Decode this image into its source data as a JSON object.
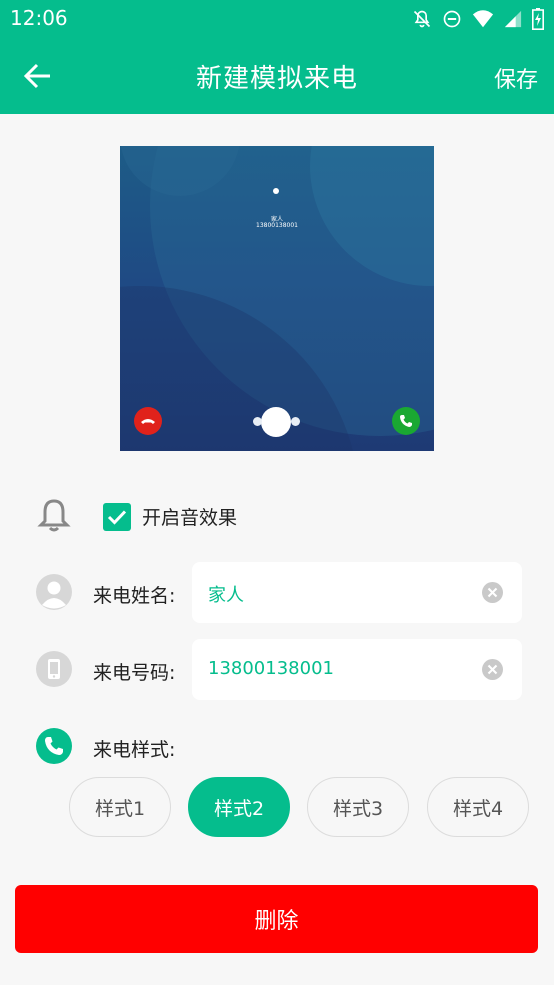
{
  "status_bar": {
    "time": "12:06",
    "icons": [
      "notifications-off-icon",
      "do-not-disturb-icon",
      "wifi-icon",
      "signal-icon",
      "battery-charging-icon"
    ]
  },
  "app_bar": {
    "back_icon": "arrow-left-icon",
    "title": "新建模拟来电",
    "save_label": "保存"
  },
  "preview": {
    "caller_name": "家人",
    "caller_number": "13800138001",
    "decline_icon": "phone-hangup-icon",
    "accept_icon": "phone-icon"
  },
  "sound": {
    "icon": "bell-icon",
    "checked": true,
    "label": "开启音效果"
  },
  "caller_name_field": {
    "icon": "avatar-icon",
    "label": "来电姓名:",
    "value": "家人"
  },
  "caller_number_field": {
    "icon": "mobile-phone-icon",
    "label": "来电号码:",
    "value": "13800138001"
  },
  "call_style": {
    "icon": "phone-icon",
    "label": "来电样式:",
    "options": [
      "样式1",
      "样式2",
      "样式3",
      "样式4"
    ],
    "selected": "样式2"
  },
  "delete_label": "删除",
  "colors": {
    "brand": "#05bd8d",
    "danger": "#ff0000",
    "background": "#f7f7f7"
  }
}
